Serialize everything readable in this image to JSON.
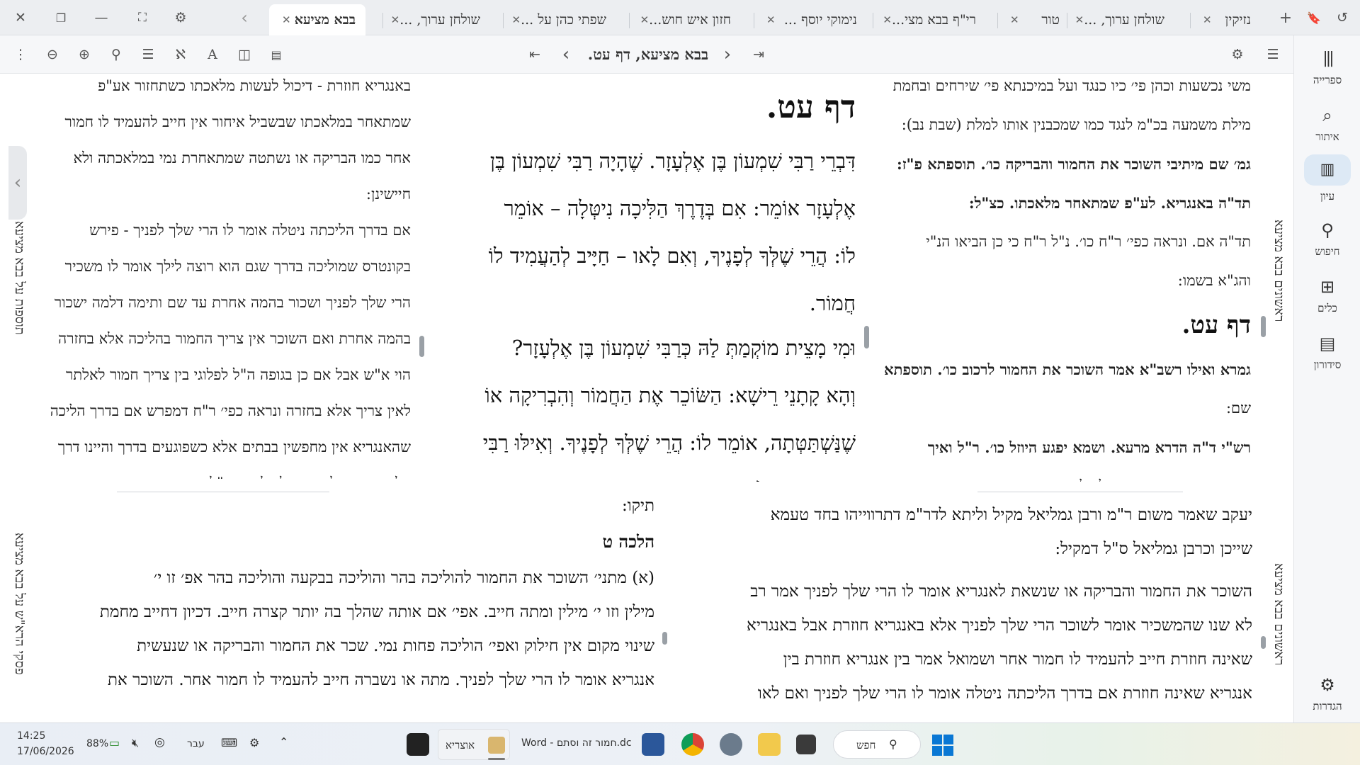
{
  "window": {
    "controls": {
      "close": "✕",
      "restore": "❐",
      "minimize": "—",
      "fullscreen": "⛶",
      "settings": "⚙",
      "tabs_scroll_left": "‹"
    },
    "right_icons": {
      "add_tab": "+",
      "bookmark": "🔖",
      "history": "↺"
    }
  },
  "tabs": [
    {
      "label": "בבא מציעא",
      "active": true
    },
    {
      "label": "שולחן ערוך, ...",
      "active": false
    },
    {
      "label": "שפתי כהן על ...",
      "active": false
    },
    {
      "label": "חזון איש חוש...",
      "active": false
    },
    {
      "label": "נימוקי יוסף ...",
      "active": false
    },
    {
      "label": "רי\"ף בבא מצי...",
      "active": false
    },
    {
      "label": "טור",
      "active": false
    },
    {
      "label": "שולחן ערוך, ...",
      "active": false
    },
    {
      "label": "נזיקין",
      "active": false
    }
  ],
  "toolbar": {
    "nav_title": "בבא מציעא, דף עט.",
    "first_page": "⇤",
    "prev_page": "‹",
    "next_page": "›",
    "last_page": "⇥"
  },
  "sidebar": {
    "items": [
      {
        "label": "ספרייה",
        "icon": "library-icon",
        "glyph": "|||"
      },
      {
        "label": "איתור",
        "icon": "locate-icon",
        "glyph": "⌕"
      },
      {
        "label": "עיון",
        "icon": "open-book-icon",
        "glyph": "📖",
        "active": true
      },
      {
        "label": "חיפוש",
        "icon": "search-icon",
        "glyph": "⚲"
      },
      {
        "label": "כלים",
        "icon": "tools-icon",
        "glyph": "⊞"
      },
      {
        "label": "סידורון",
        "icon": "prayer-book-icon",
        "glyph": "▤"
      }
    ],
    "settings_label": "הגדרות"
  },
  "panes": {
    "right_commentary": {
      "vertical_label": "ראשונים בבא מציעא",
      "lines": [
        "משי נכשעות וכהן פי׳ כיו כנגד ועל במיכנתא פי׳ שירחים ובחמת",
        "מילת משמעה בכ\"מ לנגד כמו שמכבנין אותו למלת (שבת נב):",
        "גמ׳ שם מיתיבי השוכר את החמור והבריקה כו׳. תוספתא פ\"ז:",
        "תד\"ה באנגריא. לע\"פ שמתאחר מלאכתו. כצ\"ל:",
        "תד\"ה אם. ונראה כפי׳ ר\"ח כו׳. נ\"ל ר\"ח כי כן הביאו הנ\"י",
        "והג\"א בשמו:"
      ],
      "daf_heading": "דף עט.",
      "lines2": [
        "גמרא ואילו רשב\"א אמר השוכר את החמור לרכוב כו׳. תוספתא",
        "שם:",
        "רש\"י ד\"ה הדרא מרעא. ושמא יפגע היוזל כו׳. ר\"ל ואיך",
        "סתמה הבריתא דמשמע דלעולם דינא הכי הא זימנין דגם בהד"
      ]
    },
    "main_text": {
      "daf_heading": "דף עט.",
      "lines": [
        "דִּבְרֵי רַבִּי שִׁמְעוֹן בֶּן אֶלְעָזָר. שֶׁהָיָה רַבִּי שִׁמְעוֹן בֶּן",
        "אֶלְעָזָר אוֹמֵר: אִם בְּדֶרֶךְ הַלִּיכָה נִיטְּלָה – אוֹמֵר",
        "לוֹ: הֲרֵי שֶׁלְּךָ לְפָנֶיךָ, וְאִם לָאו – חַיָּיב לְהַעֲמִיד לוֹ",
        "חֲמוֹר."
      ],
      "lines2": [
        "וּמִי מָצֵית מוֹקְמַתְּ לַהּ כְּרַבִּי שִׁמְעוֹן בֶּן אֶלְעָזָר?",
        "וְהָא קָתָנֵי רֵישָׁא: הַשּׂוֹכֵר אֶת הַחֲמוֹר וְהִבְרִיקָה אוֹ",
        "שֶׁנַּשְׁתַּטְּתָה, אוֹמֵר לוֹ: הֲרֵי שֶׁלְּךָ לְפָנֶיךָ. וְאִילּוּ רַבִּי",
        "שִׁמְעוֹן בֶּן אֶלְעָזָר אוֹמֵר: הַשּׂוֹכֵר אֶת הַחֲמוֹר"
      ]
    },
    "left_commentary": {
      "vertical_label": "תוספות על בבא מציעא",
      "lines": [
        "באנגריא חוזרת - דיכול לעשות מלאכתו כשתחזור אע\"פ",
        "שמתאחר במלאכתו שבשביל איחור אין חייב להעמיד לו חמור",
        "אחר כמו הבריקה או נשתטה שמתאחרת נמי במלאכתה ולא",
        "חיישינן:",
        "אם בדרך הליכתה ניטלה אומר לו הרי שלך לפניך - פירש",
        "בקונטרס שמוליכה בדרך שגם הוא רוצה לילך אומר לו משכיר",
        "הרי שלך לפניך ושכור בהמה אחרת עד שם ותימה דלמה ישכור",
        "בהמה אחרת ואם השוכר אין צריך החמור בהליכה אלא בחזרה",
        "הוי א\"ש אבל אם כן בגופה ה\"ל לפלוגי בין צריך חמור לאלתר",
        "לאין צריך אלא בחזרה ונראה כפי׳ ר\"ח דמפרש אם בדרך הליכה",
        "שהאנגריא אין מחפשין בבתים אלא כשפוגעים בדרך והיינו דרך",
        "הליכה אומר לו הרי שלך לפניך ונ\"ל דאין צריך"
      ]
    },
    "bottom_right": {
      "vertical_label": "ראשונים בבא מציעא",
      "lines": [
        "יעקב שאמר משום ר\"מ ורבן גמליאל מקיל וליתא לדר\"מ דתרווייהו בחד טעמא",
        "שייכן וכרבן גמליאל ס\"ל דמקיל:",
        "השוכר את החמור והבריקה או שנשאת לאנגריא אומר לו הרי שלך לפניך אמר רב",
        "לא שנו שהמשכיר אומר לשוכר הרי שלך לפניך אלא באנגריא חוזרת אבל באנגריא",
        "שאינה חוזרת חייב להעמיד לו חמור אחר ושמואל אמר בין אנגריא חוזרת בין",
        "אנגריא שאינה חוזרת אם בדרך הליכתה ניטלה אומר לו הרי שלך לפניך ואם לאו"
      ]
    },
    "bottom_left": {
      "vertical_label": "פסקי הרא\"ש על בבא מציעא",
      "top_line": "תיקו:",
      "heading": "הלכה ט",
      "lines": [
        "(א) מתני׳ השוכר את החמור להוליכה בהר והוליכה בבקעה והוליכה בהר אפ׳ זו י׳",
        "מילין וזו י׳ מילין ומתה חייב. אפי׳ אם אותה שהלך בה יותר קצרה חייב. דכיון דחייב מחמת",
        "שינוי מקום אין חילוק ואפי׳ הוליכה פחות נמי. שכר את החמור והבריקה או שנעשית",
        "אנגריא אומר לו הרי שלך לפניך. מתה או נשברה חייב להעמיד לו חמור אחר. השוכר את"
      ]
    }
  },
  "taskbar": {
    "time": "14:25",
    "date": "17/06/2026",
    "battery": "88%",
    "language": "עבר",
    "search_label": "חפש",
    "word_title": "Word - חמור זה וסתם.dc",
    "otzaria_label": "אוצריא"
  }
}
